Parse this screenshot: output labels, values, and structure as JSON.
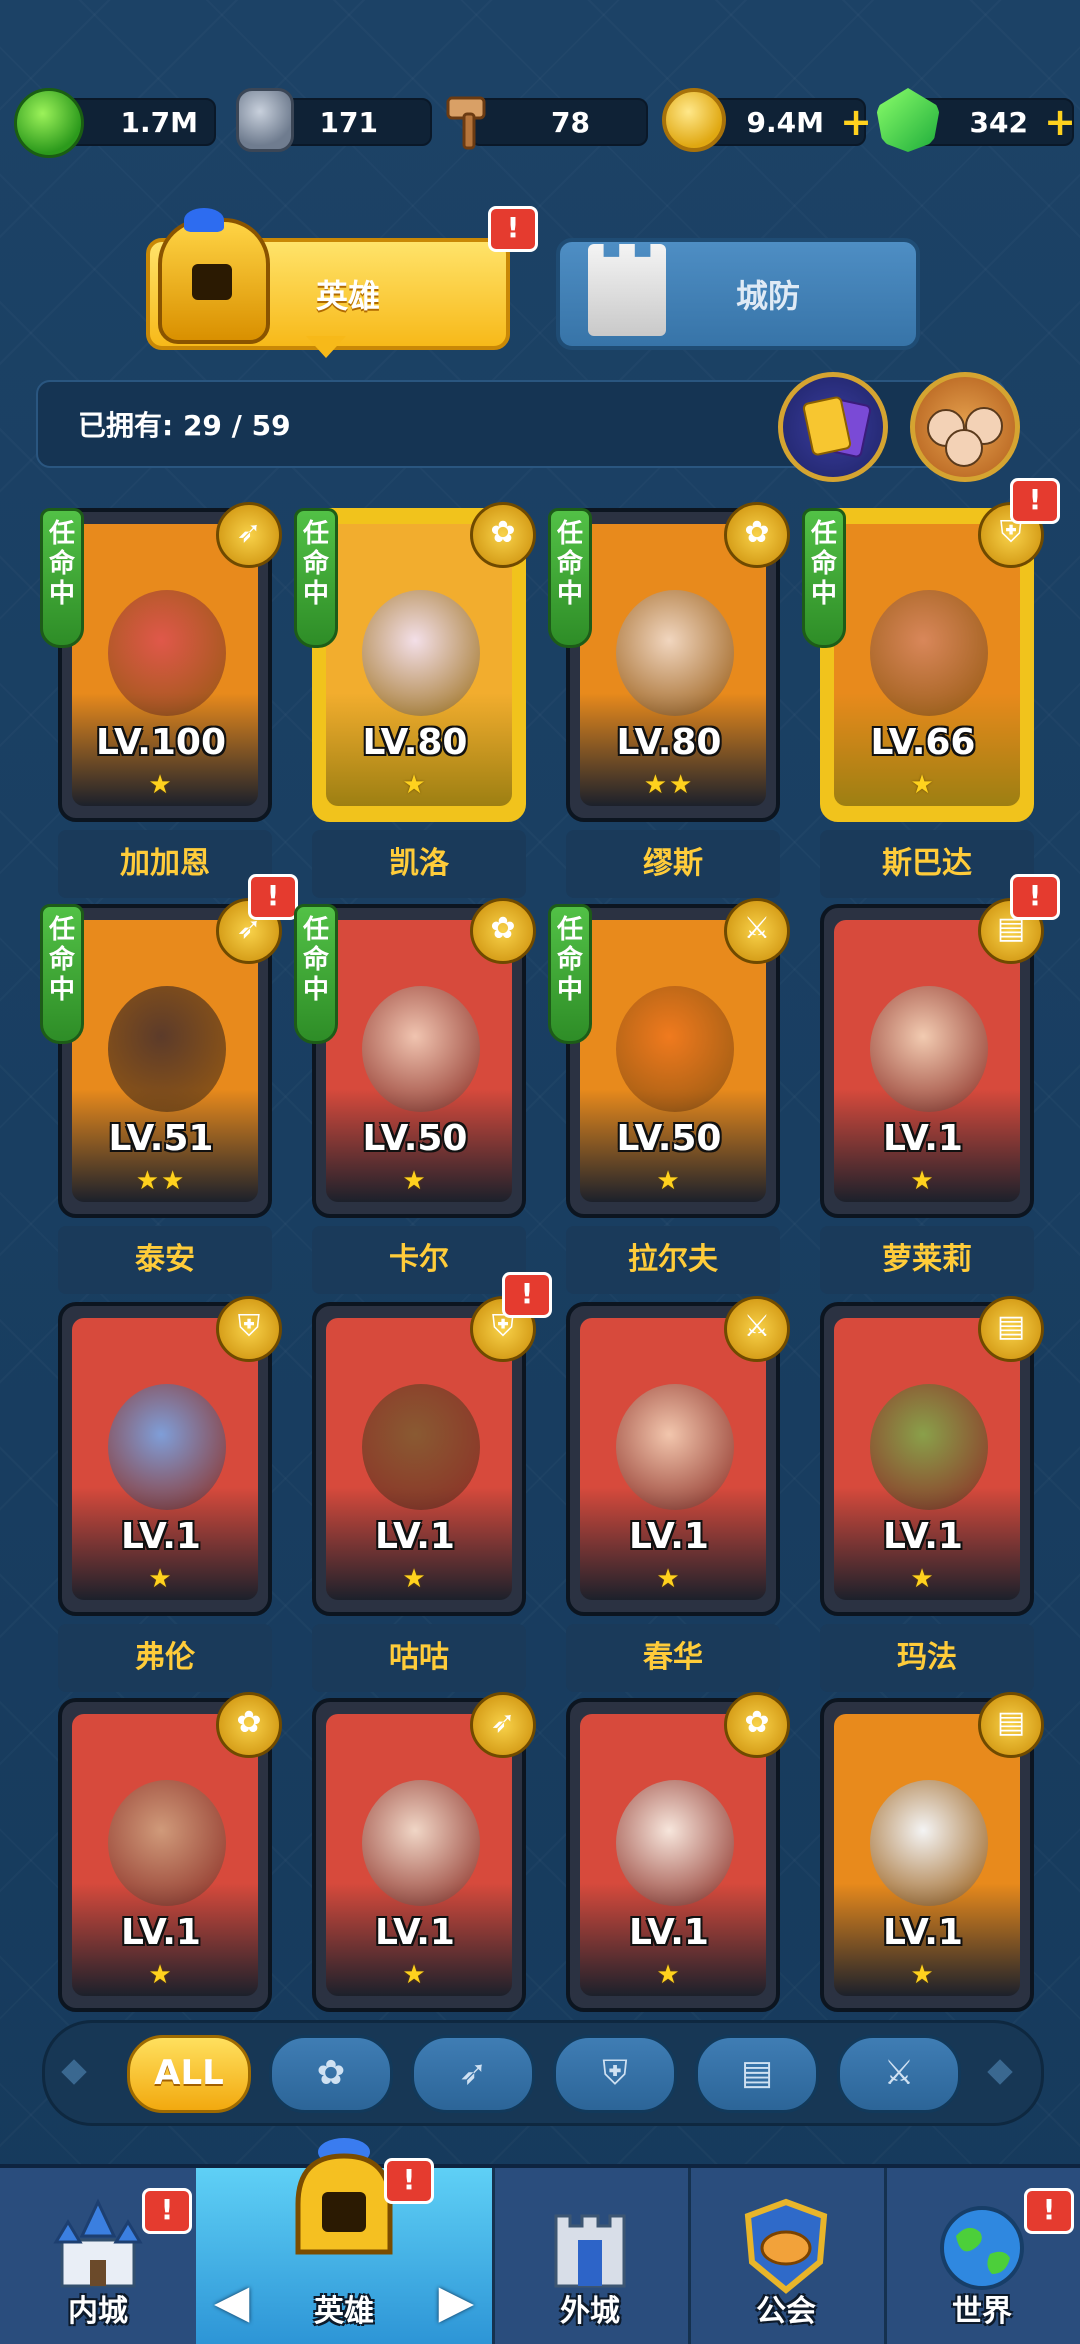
{
  "resources": [
    {
      "icon": "dragon-essence-icon",
      "value": "1.7M"
    },
    {
      "icon": "stone-rune-icon",
      "value": "171"
    },
    {
      "icon": "hammer-icon",
      "value": "78"
    },
    {
      "icon": "gold-coin-icon",
      "value": "9.4M",
      "plus": "+"
    },
    {
      "icon": "emerald-gem-icon",
      "value": "342",
      "plus": "+"
    }
  ],
  "tabs": {
    "hero": "英雄",
    "defense": "城防",
    "badge": "!"
  },
  "owned": {
    "label": "已拥有: 29 / 59"
  },
  "assign_label": "任\n命\n中",
  "heroes": [
    {
      "name": "加加恩",
      "level": "LV.100",
      "stars": "★",
      "class": "archer",
      "assigned": true,
      "color": "#e88a1c",
      "skin": "#e0584a"
    },
    {
      "name": "凯洛",
      "level": "LV.80",
      "stars": "★",
      "class": "support",
      "assigned": true,
      "color": "#f2ad2e",
      "skin": "#f3dfe8",
      "gold": true
    },
    {
      "name": "缪斯",
      "level": "LV.80",
      "stars": "★★",
      "class": "support",
      "assigned": true,
      "color": "#e88a1c",
      "skin": "#f1d6bf"
    },
    {
      "name": "斯巴达",
      "level": "LV.66",
      "stars": "★",
      "class": "tank",
      "assigned": true,
      "color": "#e88a1c",
      "skin": "#d9875a",
      "gold": true,
      "badge": true
    },
    {
      "name": "泰安",
      "level": "LV.51",
      "stars": "★★",
      "class": "archer",
      "assigned": true,
      "color": "#e88a1c",
      "skin": "#5c3b2a",
      "badge": true
    },
    {
      "name": "卡尔",
      "level": "LV.50",
      "stars": "★",
      "class": "support",
      "assigned": true,
      "color": "#d74a3c",
      "skin": "#f0c4b0"
    },
    {
      "name": "拉尔夫",
      "level": "LV.50",
      "stars": "★",
      "class": "warrior",
      "assigned": true,
      "color": "#e88a1c",
      "skin": "#f07a1e"
    },
    {
      "name": "萝莱莉",
      "level": "LV.1",
      "stars": "★",
      "class": "mage",
      "assigned": false,
      "color": "#d74a3c",
      "skin": "#f2cbb1",
      "badge": true
    },
    {
      "name": "弗伦",
      "level": "LV.1",
      "stars": "★",
      "class": "tank",
      "assigned": false,
      "color": "#d74a3c",
      "skin": "#7f9ed8"
    },
    {
      "name": "咕咕",
      "level": "LV.1",
      "stars": "★",
      "class": "tank",
      "assigned": false,
      "color": "#d74a3c",
      "skin": "#8a5a32",
      "badge": true
    },
    {
      "name": "春华",
      "level": "LV.1",
      "stars": "★",
      "class": "warrior",
      "assigned": false,
      "color": "#d74a3c",
      "skin": "#f2c6ad"
    },
    {
      "name": "玛法",
      "level": "LV.1",
      "stars": "★",
      "class": "mage",
      "assigned": false,
      "color": "#d74a3c",
      "skin": "#8aa04a"
    },
    {
      "name": "",
      "level": "LV.1",
      "stars": "★",
      "class": "support",
      "assigned": false,
      "color": "#d74a3c",
      "skin": "#d09a7a"
    },
    {
      "name": "",
      "level": "LV.1",
      "stars": "★",
      "class": "archer",
      "assigned": false,
      "color": "#d74a3c",
      "skin": "#f0d6c6"
    },
    {
      "name": "",
      "level": "LV.1",
      "stars": "★",
      "class": "support",
      "assigned": false,
      "color": "#d74a3c",
      "skin": "#f7e6dc"
    },
    {
      "name": "",
      "level": "LV.1",
      "stars": "★",
      "class": "mage",
      "assigned": false,
      "color": "#e88a1c",
      "skin": "#f4f4f4"
    }
  ],
  "filters": {
    "all": "ALL",
    "support": "support-class-icon",
    "archer": "archer-class-icon",
    "tank": "tank-class-icon",
    "mage": "mage-class-icon",
    "warrior": "warrior-class-icon"
  },
  "nav": [
    {
      "label": "内城",
      "icon": "inner-city-castle-icon",
      "badge": true
    },
    {
      "label": "英雄",
      "icon": "hero-helmet-icon",
      "badge": true,
      "active": true
    },
    {
      "label": "外城",
      "icon": "outer-city-tower-icon",
      "badge": false
    },
    {
      "label": "公会",
      "icon": "guild-handshake-icon",
      "badge": false
    },
    {
      "label": "世界",
      "icon": "world-globe-icon",
      "badge": true
    }
  ],
  "nav_arrows": {
    "left": "◀",
    "right": "▶"
  },
  "class_glyphs": {
    "archer": "➶",
    "support": "✿",
    "tank": "⛨",
    "mage": "▤",
    "warrior": "⚔"
  }
}
